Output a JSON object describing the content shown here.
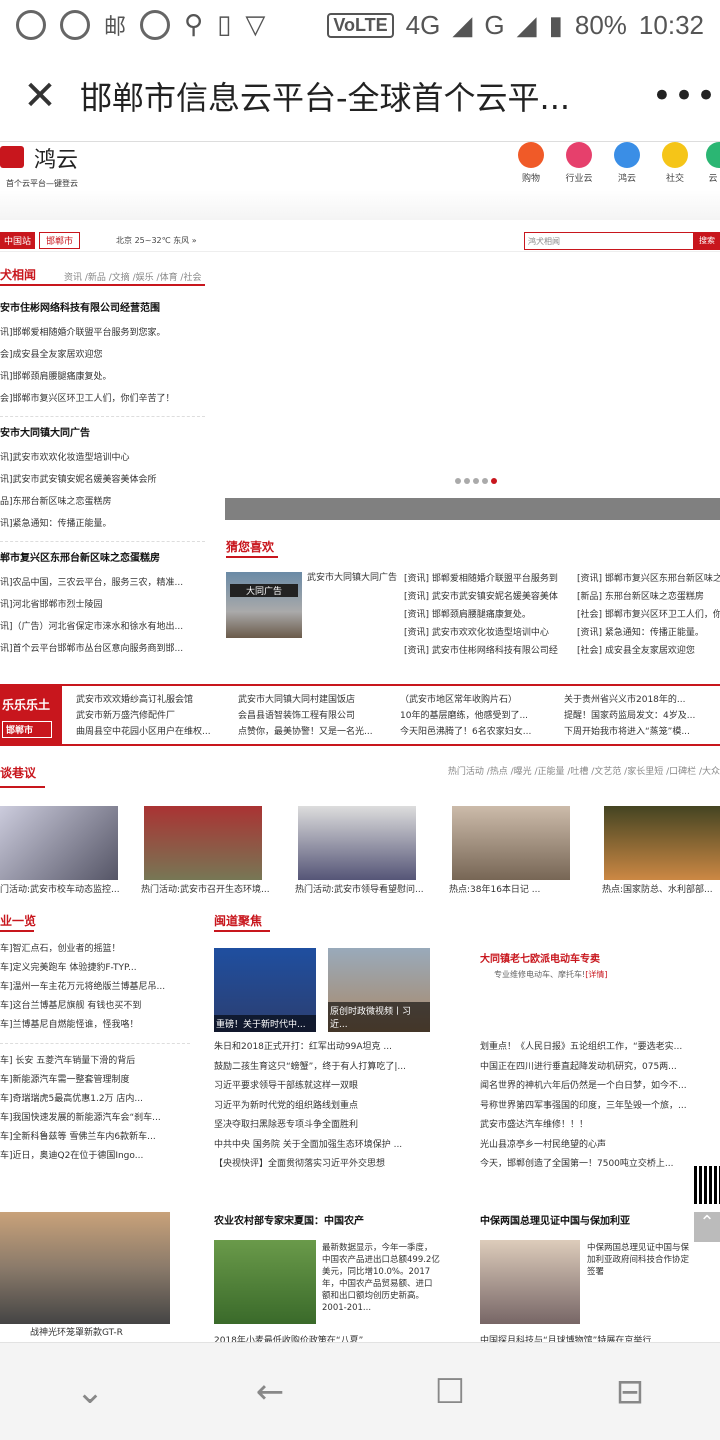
{
  "status": {
    "battery": "80%",
    "time": "10:32",
    "volte": "VoLTE",
    "net1": "4G",
    "net2": "G"
  },
  "title": {
    "text": "邯郸市信息云平台-全球首个云平...",
    "close": "✕",
    "more": "•••"
  },
  "site": {
    "logo_text": "鸿云",
    "logo_sub": "首个云平台—键登云",
    "nav": [
      {
        "label": "购物",
        "color": "#f05a28"
      },
      {
        "label": "行业云",
        "color": "#e6406c"
      },
      {
        "label": "鸿云",
        "color": "#3a8ee6"
      },
      {
        "label": "社交",
        "color": "#f5c518"
      },
      {
        "label": "云",
        "color": "#2bb673"
      }
    ],
    "station": "中国站",
    "city": "邯郸市",
    "weather": "北京  25~32℃ 东风 »",
    "search_placeholder": "鸿犬相闻",
    "search_btn": "搜索"
  },
  "left": {
    "title": "犬相闻",
    "tabs": "资讯 /新品 /文摘 /娱乐 /体育 /社会",
    "group1_hd": "安市住彬网络科技有限公司经营范围",
    "group1": [
      "讯]邯郸爱相随婚介联盟平台服务到您家。",
      "会]成安县全友家居欢迎您",
      "讯]邯郸颈肩腰腿痛康复处。",
      "会]邯郸市复兴区环卫工人们，你们辛苦了！"
    ],
    "group2_hd": "安市大同镇大同广告",
    "group2": [
      "讯]武安市欢欢化妆造型培训中心",
      "讯]武安市武安镇安妮名媛美容美体会所",
      "品]东邢台新区味之恋蛋糕房",
      "讯]紧急通知：传播正能量。"
    ],
    "group3_hd": "郸市复兴区东邢台新区味之恋蛋糕房",
    "group3": [
      "讯]农品中国，三农云平台，服务三农，精准...",
      "讯]河北省邯郸市烈士陵园",
      "讯]（广告）河北省保定市涞水和徐水有地出...",
      "讯]首个云平台邯郸市丛台区意向服务商到邯..."
    ]
  },
  "guess": {
    "title": "猜您喜欢",
    "img_cap": "武安市大同镇大同广告",
    "img_sign": "大同广告",
    "col1": [
      "[资讯] 邯郸爱相随婚介联盟平台服务到",
      "[资讯] 武安市武安镇安妮名媛美容美体",
      "[资讯] 邯郸颈肩腰腿痛康复处。",
      "[资讯] 武安市欢欢化妆造型培训中心",
      "[资讯] 武安市住彬网络科技有限公司经"
    ],
    "col2": [
      "[资讯] 邯郸市复兴区东邢台新区味之",
      "[新品] 东邢台新区味之恋蛋糕房",
      "[社会] 邯郸市复兴区环卫工人们，你",
      "[资讯] 紧急通知：传播正能量。",
      "[社会] 成安县全友家居欢迎您"
    ]
  },
  "happy": {
    "label": "乐乐乐土",
    "city": "邯郸市",
    "cols": [
      [
        "武安市欢欢婚纱高订礼服会馆",
        "武安市新万盛汽修配件厂",
        "曲周县空中花园小区用户在维权..."
      ],
      [
        "武安市大同镇大同村建国饭店",
        "会昌县语智装饰工程有限公司",
        "点赞你，最美协警！又是一名光..."
      ],
      [
        "（武安市地区常年收购片石）",
        "10年的基层磨练，他感受到了...",
        "今天阳邑沸腾了！6名农家妇女..."
      ],
      [
        "关于贵州省兴义市2018年的...",
        "提醒！国家药监局发文：4岁及...",
        "下周开始我市将进入“蒸笼”模..."
      ]
    ]
  },
  "talk": {
    "title": "谈巷议",
    "tabs": "热门活动 /热点 /曝光 /正能量 /吐槽 /文艺范 /家长里短 /口碑栏 /大众",
    "caps": [
      "门活动:武安市校车动态监控...",
      "热门活动:武安市召开生态环境...",
      "热门活动:武安市领导看望慰问...",
      "热点:38年16本日记 ...",
      "热点:国家防总、水利部部..."
    ]
  },
  "auto": {
    "title": "业一览",
    "items": [
      "车]智汇点石，创业者的摇篮！",
      "车]定义完美跑车 体验捷豹F-TYP...",
      "车]温州一车主花万元将绝版兰博基尼吊...",
      "车]这台兰博基尼旗舰 有钱也买不到",
      "车]兰博基尼自燃能怪谁，怪我咯！",
      "车] 长安 五菱汽车销量下滑的背后",
      "车]新能源汽车需一整套管理制度",
      "车]奇瑞瑞虎5最高优惠1.2万 店内...",
      "车]我国快速发展的新能源汽车会“刹车...",
      "车]全新科鲁兹等 雪佛兰车内6款新车...",
      "车]近日，奥迪Q2在位于德国Ingo..."
    ],
    "car_cap": "战神光环笼罩新款GT-R"
  },
  "focus": {
    "title": "闽道聚焦",
    "img1_cap": "重磅！关于新时代中...",
    "img2_cap": "原创时政微视频丨习近...",
    "items": [
      "朱日和2018正式开打：红军出动99A坦克 ...",
      "鼓励二孩生育这只“螃蟹”，终于有人打算吃了|...",
      "习近平要求领导干部练就这样一双眼",
      "习近平为新时代党的组织路线划重点",
      "坚决夺取扫黑除恶专项斗争全面胜利",
      "中共中央 国务院 关于全面加强生态环境保护 ...",
      "【央视快评】全面贯彻落实习近平外交思想"
    ]
  },
  "ad": {
    "title": "大同镇老七欧派电动车专卖",
    "sub": "专业维修电动车、摩托车!",
    "more": "[详情]",
    "items": [
      "划重点！《人民日报》五论组织工作，“要选老实...",
      "中国正在四川进行垂直起降发动机研究，075两...",
      "闻名世界的神机六年后仍然是一个白日梦，如今不...",
      "号称世界第四军事强国的印度，三年坠毁一个旅，...",
      "武安市盛达汽车维修！！！",
      "光山县凉亭乡一村民绝望的心声",
      "今天，邯郸创造了全国第一！7500吨立交桥上..."
    ]
  },
  "agri": {
    "title": "农业农村部专家宋夏国：中国农产",
    "text": "最新数据显示，今年一季度，中国农产品进出口总额499.2亿美元，同比增10.0%。2017年，中国农产品贸易额、进口额和出口额均创历史新高。2001-201...",
    "foot": "2018年小麦最低收购价政策在“八夏”"
  },
  "bulg": {
    "title": "中保两国总理见证中国与保加利亚",
    "text": "中保两国总理见证中国与保加利亚政府间科技合作协定签署",
    "foot": "中国探月科技与“月球博物馆”特展在京举行"
  },
  "navbar": {
    "down": "⌄",
    "back": "←",
    "home": "☐",
    "recent": "⊟"
  }
}
